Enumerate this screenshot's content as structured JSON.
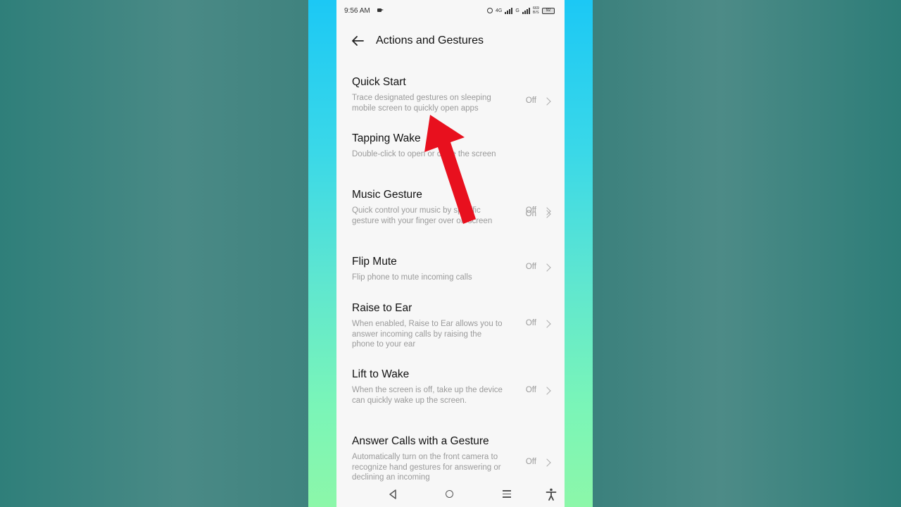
{
  "status": {
    "time": "9:56 AM",
    "net1": "4G",
    "net2": "G",
    "speed": "669",
    "speed_unit": "B/S",
    "battery": "92"
  },
  "header": {
    "title": "Actions and Gestures"
  },
  "items": [
    {
      "title": "Quick Start",
      "desc": "Trace designated gestures on sleeping mobile screen to quickly open apps",
      "state": "Off"
    },
    {
      "title": "Tapping Wake",
      "desc": "Double-click to open or close the screen",
      "state": "On"
    },
    {
      "title": "Music Gesture",
      "desc": "Quick control your music by specific gesture with your finger over off-screen",
      "state": "Off"
    },
    {
      "title": "Flip Mute",
      "desc": "Flip phone to mute incoming calls",
      "state": "Off"
    },
    {
      "title": "Raise to Ear",
      "desc": "When enabled, Raise to Ear allows you to answer incoming calls by raising the phone to your ear",
      "state": "Off"
    },
    {
      "title": "Lift to Wake",
      "desc": "When the screen is off, take up the device can quickly wake up the screen.",
      "state": "Off"
    },
    {
      "title": "Answer Calls with a Gesture",
      "desc": "Automatically turn on the front camera to recognize hand gestures for answering or declining an incoming",
      "state": "Off"
    }
  ],
  "colors": {
    "arrow": "#e8101e",
    "frame_top": "#1cc8f5",
    "frame_bottom": "#8cf7a9"
  },
  "icons": {
    "back": "arrow-left-icon",
    "nav_back": "triangle-back-icon",
    "nav_home": "circle-home-icon",
    "nav_menu": "menu-lines-icon",
    "nav_access": "accessibility-icon"
  }
}
